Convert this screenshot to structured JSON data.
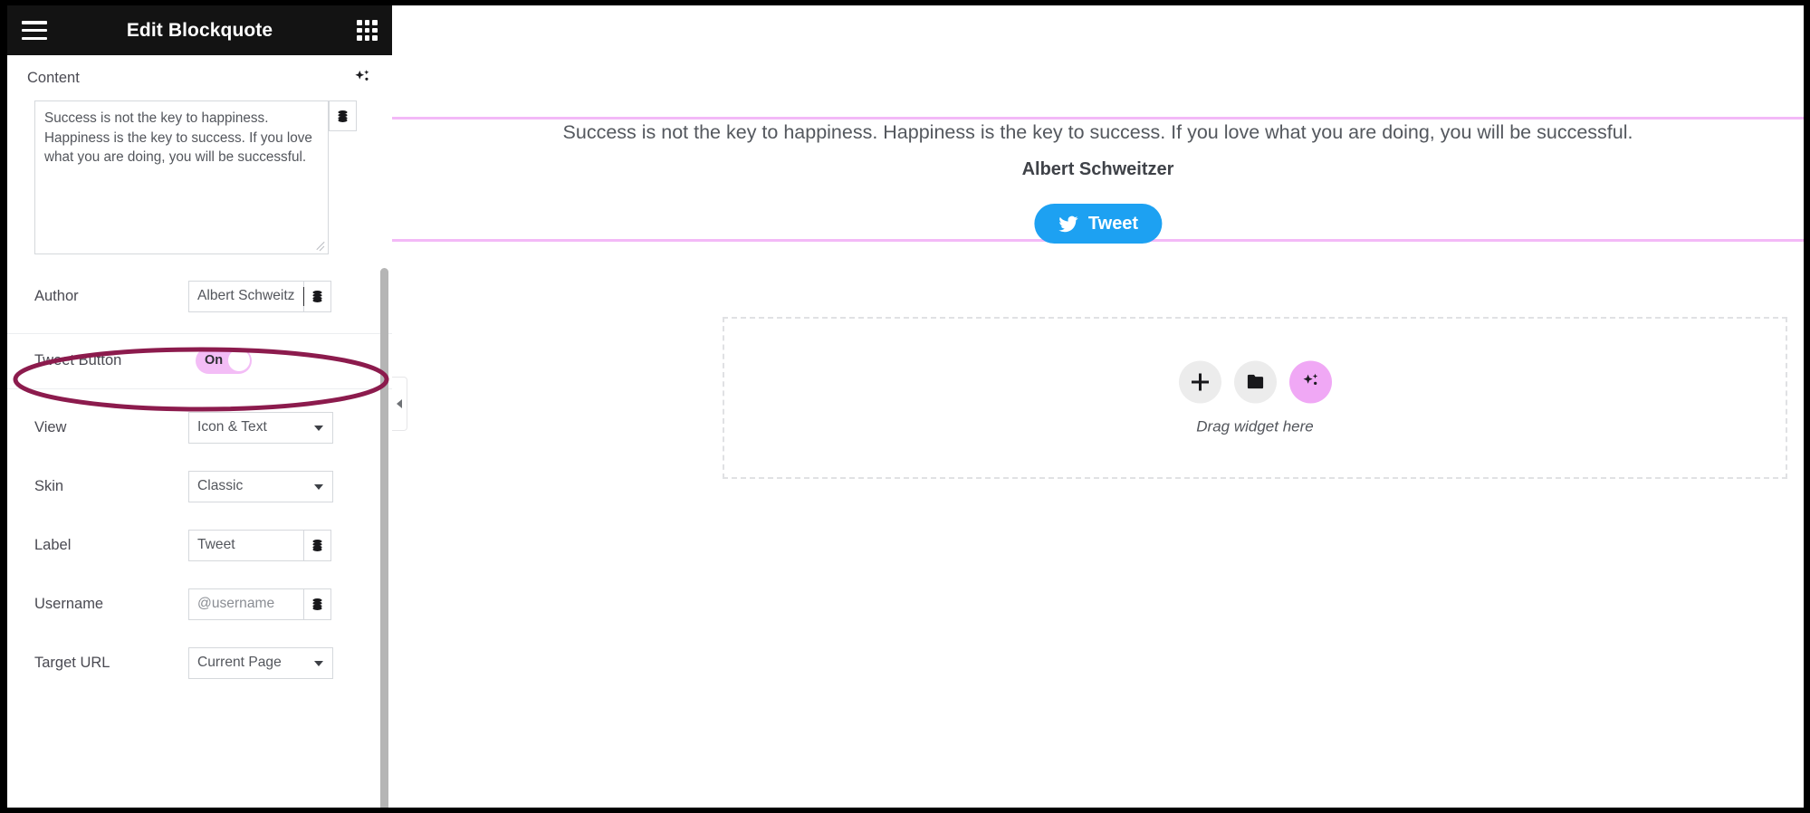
{
  "panel": {
    "title": "Edit Blockquote",
    "menu_icon": "hamburger-icon",
    "apps_icon": "grid-icon",
    "content": {
      "label": "Content",
      "ai_icon": "ai-sparkle-icon",
      "textarea_value": "Success is not the key to happiness. Happiness is the key to success. If you love what you are doing, you will be successful.",
      "dynamic_icon": "database-icon"
    },
    "fields": {
      "author": {
        "label": "Author",
        "value": "Albert Schweitzer",
        "dynamic_icon": "database-icon"
      },
      "tweet_button": {
        "label": "Tweet Button",
        "state": "On"
      },
      "view": {
        "label": "View",
        "value": "Icon & Text"
      },
      "skin": {
        "label": "Skin",
        "value": "Classic"
      },
      "label": {
        "label": "Label",
        "value": "Tweet",
        "dynamic_icon": "database-icon"
      },
      "username": {
        "label": "Username",
        "value": "",
        "placeholder": "@username",
        "dynamic_icon": "database-icon"
      },
      "target_url": {
        "label": "Target URL",
        "value": "Current Page"
      }
    }
  },
  "canvas": {
    "quote": "Success is not the key to happiness. Happiness is the key to success. If you love what you are doing, you will be successful.",
    "author": "Albert Schweitzer",
    "tweet_label": "Tweet",
    "tweet_icon": "twitter-bird-icon",
    "collapse_icon": "chevron-left-icon",
    "dropzone": {
      "label": "Drag widget here",
      "add_icon": "plus-icon",
      "folder_icon": "folder-icon",
      "ai_icon": "ai-sparkle-icon"
    }
  },
  "colors": {
    "header_bg": "#131313",
    "toggle_on": "#f3bdf6",
    "guideline": "#f3b9f7",
    "twitter_blue": "#1da1f2",
    "annotation": "#8c1b4d",
    "ai_pink": "#f0a8f5"
  }
}
